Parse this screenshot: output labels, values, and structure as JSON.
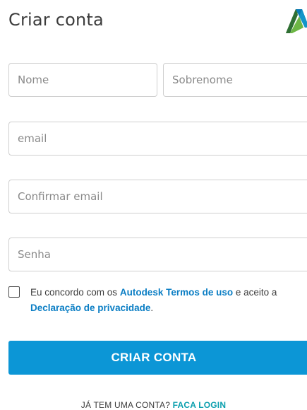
{
  "header": {
    "title": "Criar conta",
    "logo_icon": "autodesk-logo-icon"
  },
  "form": {
    "nome_placeholder": "Nome",
    "sobrenome_placeholder": "Sobrenome",
    "email_placeholder": "email",
    "confirm_email_placeholder": "Confirmar email",
    "senha_placeholder": "Senha",
    "nome_value": "",
    "sobrenome_value": "",
    "email_value": "",
    "confirm_email_value": "",
    "senha_value": ""
  },
  "terms": {
    "checked": false,
    "text_before": "Eu concordo com os ",
    "link_terms": "Autodesk Termos de uso",
    "text_middle": " e aceito a ",
    "link_privacy": "Declaração de privacidade",
    "text_after": "."
  },
  "submit": {
    "label": "CRIAR CONTA"
  },
  "login": {
    "prompt": "JÁ TEM UMA CONTA? ",
    "link": "FACA LOGIN"
  },
  "colors": {
    "accent": "#0c96d6",
    "link": "#0b7ec4",
    "login_link": "#0b9fae",
    "text": "#3c3c3c",
    "border": "#cfcfcf"
  }
}
